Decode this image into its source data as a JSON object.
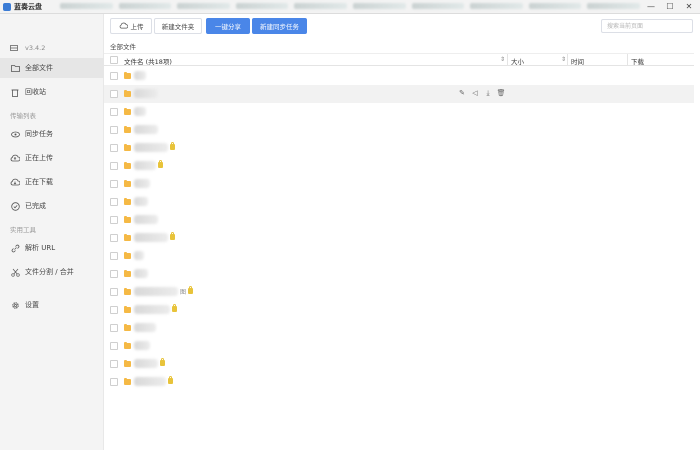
{
  "window": {
    "title": "蓝奏云盘",
    "controls": {
      "minimize": "—",
      "maximize": "☐",
      "close": "✕"
    }
  },
  "sidebar": {
    "version": "v3.4.2",
    "items": [
      {
        "label": "全部文件",
        "icon": "folder-open-icon",
        "active": true
      },
      {
        "label": "回收站",
        "icon": "trash-icon",
        "active": false
      }
    ],
    "transfer_section": "传输列表",
    "transfer_items": [
      {
        "label": "同步任务",
        "icon": "eye-icon"
      },
      {
        "label": "正在上传",
        "icon": "cloud-upload-icon"
      },
      {
        "label": "正在下载",
        "icon": "cloud-download-icon"
      },
      {
        "label": "已完成",
        "icon": "check-circle-icon"
      }
    ],
    "tools_section": "实用工具",
    "tool_items": [
      {
        "label": "解析 URL",
        "icon": "link-icon"
      },
      {
        "label": "文件分割 / 合并",
        "icon": "scissors-icon"
      }
    ],
    "settings": {
      "label": "设置",
      "icon": "gear-icon"
    }
  },
  "toolbar": {
    "upload": "上传",
    "new_folder": "新建文件夹",
    "share": "一键分享",
    "sync_task": "新建同步任务",
    "search_placeholder": "搜索当前页面"
  },
  "breadcrumb": "全部文件",
  "table": {
    "headers": {
      "name": "文件名 (共18项)",
      "size": "大小",
      "time": "时间",
      "download": "下载"
    },
    "row_count": 18,
    "hovered_row": 1,
    "row_actions": [
      "edit-icon",
      "share-icon",
      "download-icon",
      "delete-icon"
    ],
    "rows": [
      {
        "locked": false,
        "extra": ""
      },
      {
        "locked": false,
        "extra": ""
      },
      {
        "locked": false,
        "extra": ""
      },
      {
        "locked": false,
        "extra": ""
      },
      {
        "locked": true,
        "extra": ""
      },
      {
        "locked": true,
        "extra": ""
      },
      {
        "locked": false,
        "extra": ""
      },
      {
        "locked": false,
        "extra": ""
      },
      {
        "locked": false,
        "extra": ""
      },
      {
        "locked": true,
        "extra": ""
      },
      {
        "locked": false,
        "extra": ""
      },
      {
        "locked": false,
        "extra": ""
      },
      {
        "locked": true,
        "extra": "图"
      },
      {
        "locked": true,
        "extra": ""
      },
      {
        "locked": false,
        "extra": ""
      },
      {
        "locked": false,
        "extra": ""
      },
      {
        "locked": true,
        "extra": ""
      },
      {
        "locked": true,
        "extra": ""
      }
    ]
  },
  "colors": {
    "primary": "#4a86e8",
    "folder": "#f5b945",
    "lock": "#e8c33a",
    "sidebar_bg": "#f4f4f4"
  }
}
